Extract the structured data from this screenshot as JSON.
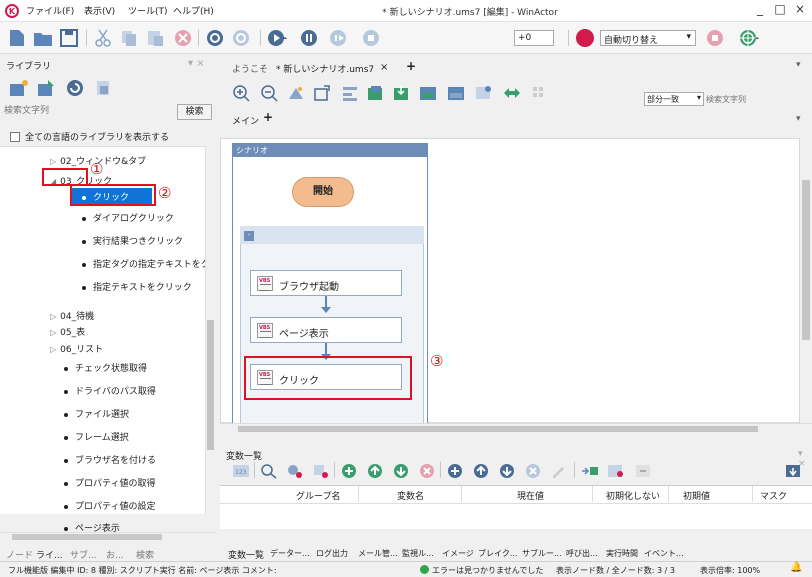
{
  "titlebar": {
    "menus": [
      "ファイル(F)",
      "表示(V)",
      "ツール(T)",
      "ヘルプ(H)"
    ],
    "title": "* 新しいシナリオ.ums7 [編集] - WinActor",
    "minimize": "_",
    "maximize": "□",
    "close": "×"
  },
  "toolbar": {
    "speed_value": "+0",
    "mode_value": "自動切り替え"
  },
  "library": {
    "title": "ライブラリ",
    "close": "▾ ×",
    "search_placeholder": "検索文字列",
    "search_button": "検索",
    "show_all_label": "全ての言語のライブラリを表示する",
    "tree": [
      {
        "label": "02_ウィンドウ&タブ",
        "kind": "folder",
        "expanded": false
      },
      {
        "label": "03_クリック",
        "kind": "folder",
        "expanded": true
      },
      {
        "label": "クリック",
        "kind": "leaf",
        "selected": true
      },
      {
        "label": "ダイアログクリック",
        "kind": "leaf"
      },
      {
        "label": "実行結果つきクリック",
        "kind": "leaf"
      },
      {
        "label": "指定タグの指定テキストをク!",
        "kind": "leaf"
      },
      {
        "label": "指定テキストをクリック",
        "kind": "leaf"
      },
      {
        "label": "04_待機",
        "kind": "folder",
        "expanded": false
      },
      {
        "label": "05_表",
        "kind": "folder",
        "expanded": false
      },
      {
        "label": "06_リスト",
        "kind": "folder",
        "expanded": false
      },
      {
        "label": "チェック状態取得",
        "kind": "leaf"
      },
      {
        "label": "ドライバのパス取得",
        "kind": "leaf"
      },
      {
        "label": "ファイル選択",
        "kind": "leaf"
      },
      {
        "label": "フレーム選択",
        "kind": "leaf"
      },
      {
        "label": "ブラウザ名を付ける",
        "kind": "leaf"
      },
      {
        "label": "プロパティ値の取得",
        "kind": "leaf"
      },
      {
        "label": "プロパティ値の設定",
        "kind": "leaf"
      },
      {
        "label": "ページ表示",
        "kind": "leaf"
      }
    ],
    "bottom_tabs": [
      "ノード",
      "ライ...",
      "サブ...",
      "お...",
      "検索"
    ]
  },
  "annotations": {
    "one": "①",
    "two": "②",
    "three": "③"
  },
  "editor": {
    "tabs": [
      "ようこそ",
      "* 新しいシナリオ.ums7"
    ],
    "tab_close": "×",
    "tab_add": "+",
    "match_value": "部分一致",
    "search_placeholder": "検索文字列",
    "sub_tab": "メイン",
    "sub_tab_add": "+",
    "scenario_label": "シナリオ",
    "start_label": "開始",
    "group_toggle": "-",
    "nodes": [
      "ブラウザ起動",
      "ページ表示",
      "クリック"
    ]
  },
  "variables": {
    "title": "変数一覧",
    "close": "▾ ×",
    "columns": [
      "グループ名",
      "変数名",
      "現在値",
      "初期化しない",
      "初期値",
      "マスク"
    ],
    "bottom_tabs": [
      "変数一覧",
      "データー...",
      "ログ出力",
      "メール管...",
      "監視ル...",
      "イメージ",
      "ブレイク...",
      "サブルー...",
      "呼び出...",
      "実行時間",
      "イベント..."
    ]
  },
  "statusbar": {
    "left": "フル機能版  編集中  ID: 8 種別: スクリプト実行 名前: ページ表示 コメント:",
    "center": "エラーは見つかりませんでした",
    "node_count": "表示ノード数 / 全ノード数: 3 / 3",
    "zoom": "表示倍率: 100%",
    "bell": "🔔"
  }
}
